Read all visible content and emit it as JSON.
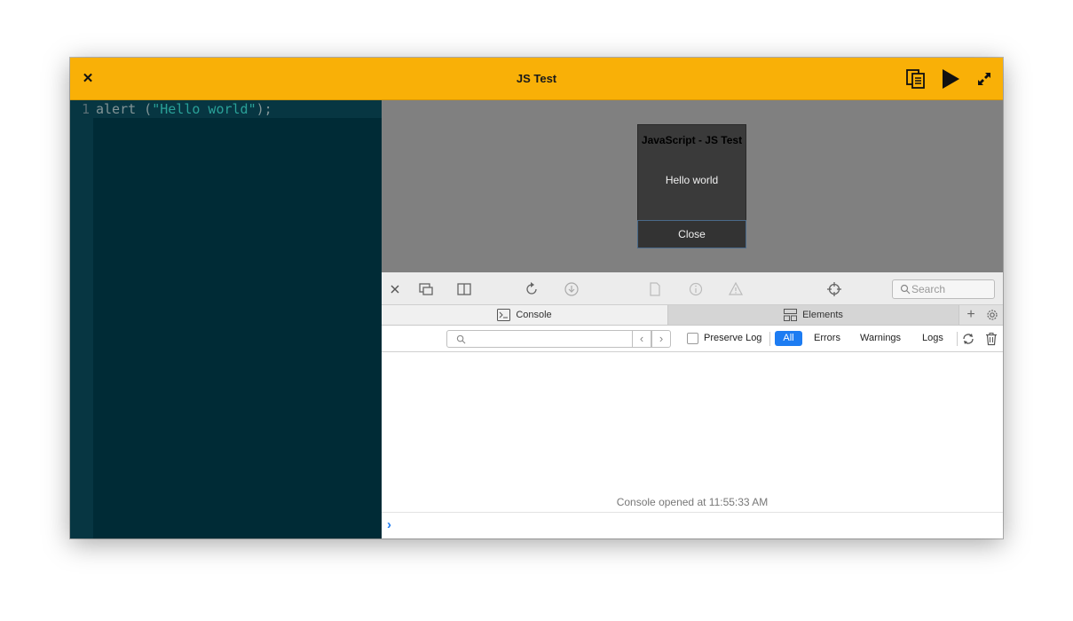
{
  "window": {
    "title": "JS Test"
  },
  "titlebar": {
    "close_icon": "close-icon",
    "copy_icon": "copy-document-icon",
    "run_icon": "play-icon",
    "fullscreen_icon": "expand-icon",
    "accent_color": "#f9b007"
  },
  "editor": {
    "line_number": "1",
    "code_tokens": [
      "alert (",
      "\"Hello world\"",
      ");"
    ],
    "background_color": "#002b36"
  },
  "alert": {
    "title": "JavaScript - JS Test",
    "message": "Hello world",
    "close_label": "Close"
  },
  "devtools": {
    "search_placeholder": "Search",
    "tabs": [
      {
        "label": "Console",
        "icon": "console-icon",
        "active": true
      },
      {
        "label": "Elements",
        "icon": "elements-icon",
        "active": false
      }
    ],
    "filter": {
      "input_placeholder": "",
      "preserve_log_label": "Preserve Log",
      "levels": [
        "All",
        "Errors",
        "Warnings",
        "Logs"
      ],
      "selected_level": "All"
    },
    "console_message": "Console opened at 11:55:33 AM",
    "prompt_symbol": "›"
  }
}
